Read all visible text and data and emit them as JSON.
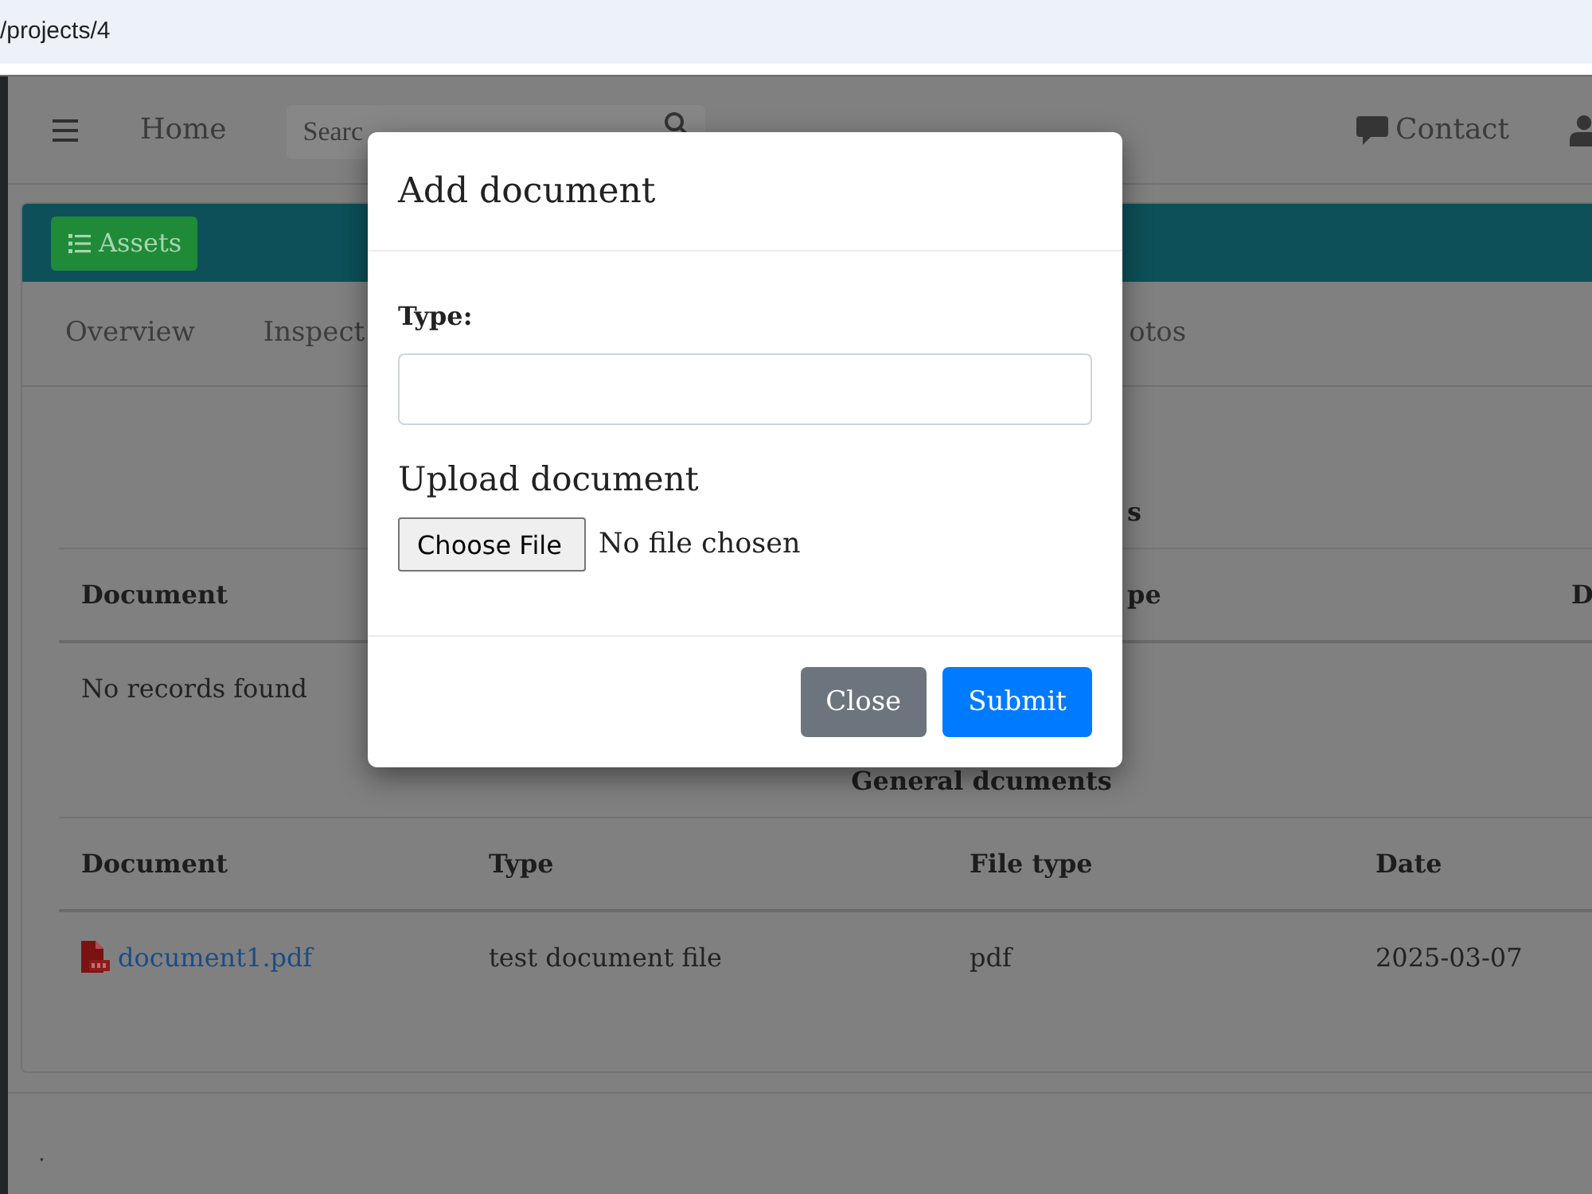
{
  "browser": {
    "url": "/projects/4"
  },
  "navbar": {
    "home": "Home",
    "search": {
      "placeholder": "Searc"
    },
    "contact": "Contact"
  },
  "toolbar": {
    "button": "Assets"
  },
  "tabs": [
    {
      "label": "Overview",
      "selected": false
    },
    {
      "label": "Inspect",
      "selected": false
    },
    {
      "label": "otos",
      "selected": false
    }
  ],
  "sections": [
    {
      "title": "s",
      "columns": [
        "Document",
        "pe",
        "D"
      ],
      "empty_text": "No records found"
    },
    {
      "title": "General dcuments",
      "columns": [
        "Document",
        "Type",
        "File type",
        "Date"
      ],
      "rows": [
        [
          {
            "kind": "file_link",
            "text": "document1.pdf"
          },
          {
            "kind": "text",
            "text": "test document file"
          },
          {
            "kind": "text",
            "text": "pdf"
          },
          {
            "kind": "text",
            "text": "2025-03-07"
          }
        ]
      ]
    }
  ],
  "footer": {
    "text": "."
  },
  "modal": {
    "title": "Add document",
    "fields": [
      {
        "kind": "text",
        "label": "Type:"
      },
      {
        "kind": "file",
        "label": "Upload document",
        "button": "Choose File",
        "status": "No file chosen"
      }
    ],
    "buttons": [
      {
        "kind": "secondary",
        "label": "Close"
      },
      {
        "kind": "primary",
        "label": "Submit"
      }
    ]
  }
}
